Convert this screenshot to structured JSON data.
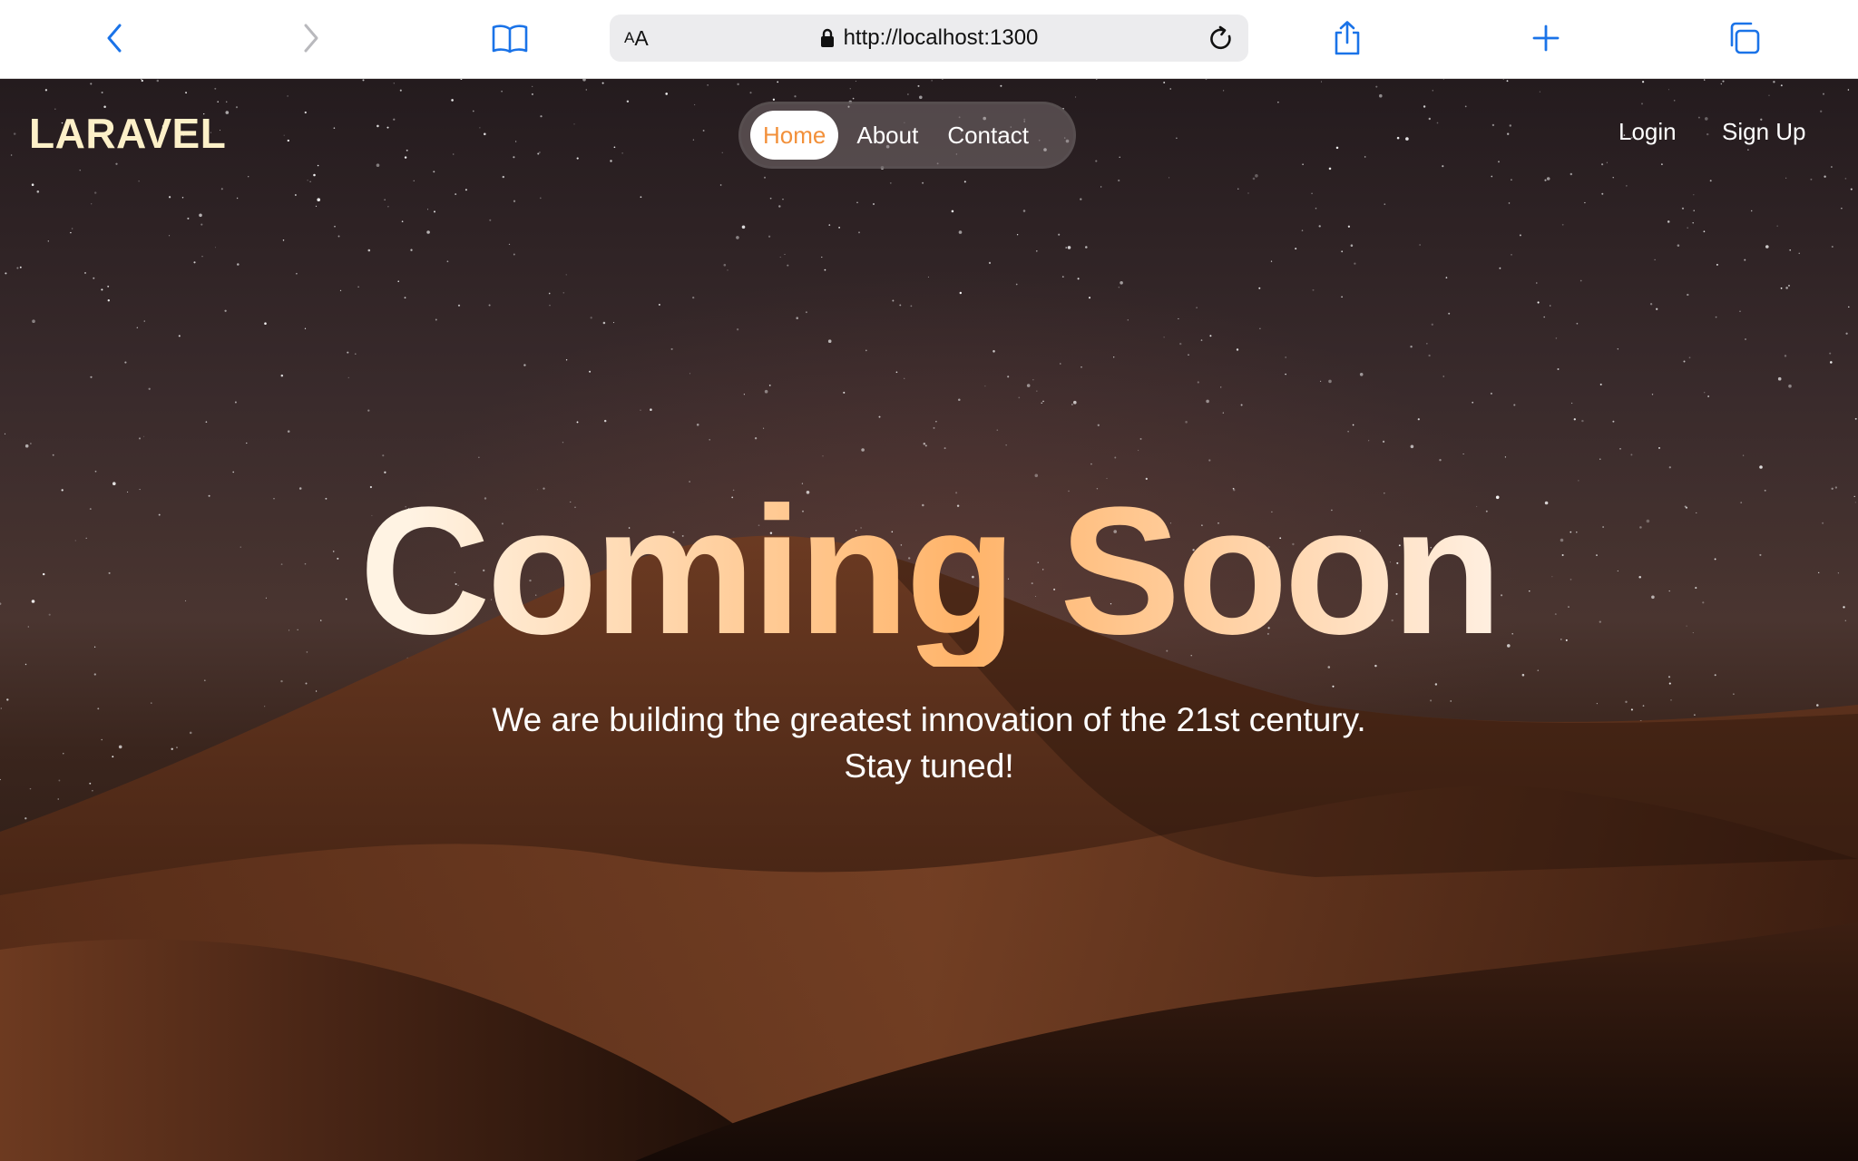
{
  "browser": {
    "text_size_label_small": "A",
    "text_size_label_large": "A",
    "url": "http://localhost:1300",
    "icons": {
      "back": "chevron-left-icon",
      "forward": "chevron-right-icon",
      "reader": "book-icon",
      "lock": "lock-icon",
      "reload": "reload-icon",
      "share": "share-icon",
      "new_tab": "plus-icon",
      "tabs": "tabs-icon"
    },
    "accent_color": "#1a73e8"
  },
  "site": {
    "logo": "LARAVEL",
    "nav": {
      "items": [
        {
          "label": "Home",
          "active": true
        },
        {
          "label": "About",
          "active": false
        },
        {
          "label": "Contact",
          "active": false
        }
      ]
    },
    "auth": {
      "login": "Login",
      "signup": "Sign Up"
    },
    "hero": {
      "headline": "Coming Soon",
      "tagline_line1": "We are building the greatest innovation of the 21st century.",
      "tagline_line2": "Stay tuned!"
    },
    "colors": {
      "logo": "#fdf0c8",
      "active_nav_text": "#f2903a",
      "headline_gradient": [
        "#fff3e3",
        "#ffb46a",
        "#ffeede"
      ]
    }
  }
}
